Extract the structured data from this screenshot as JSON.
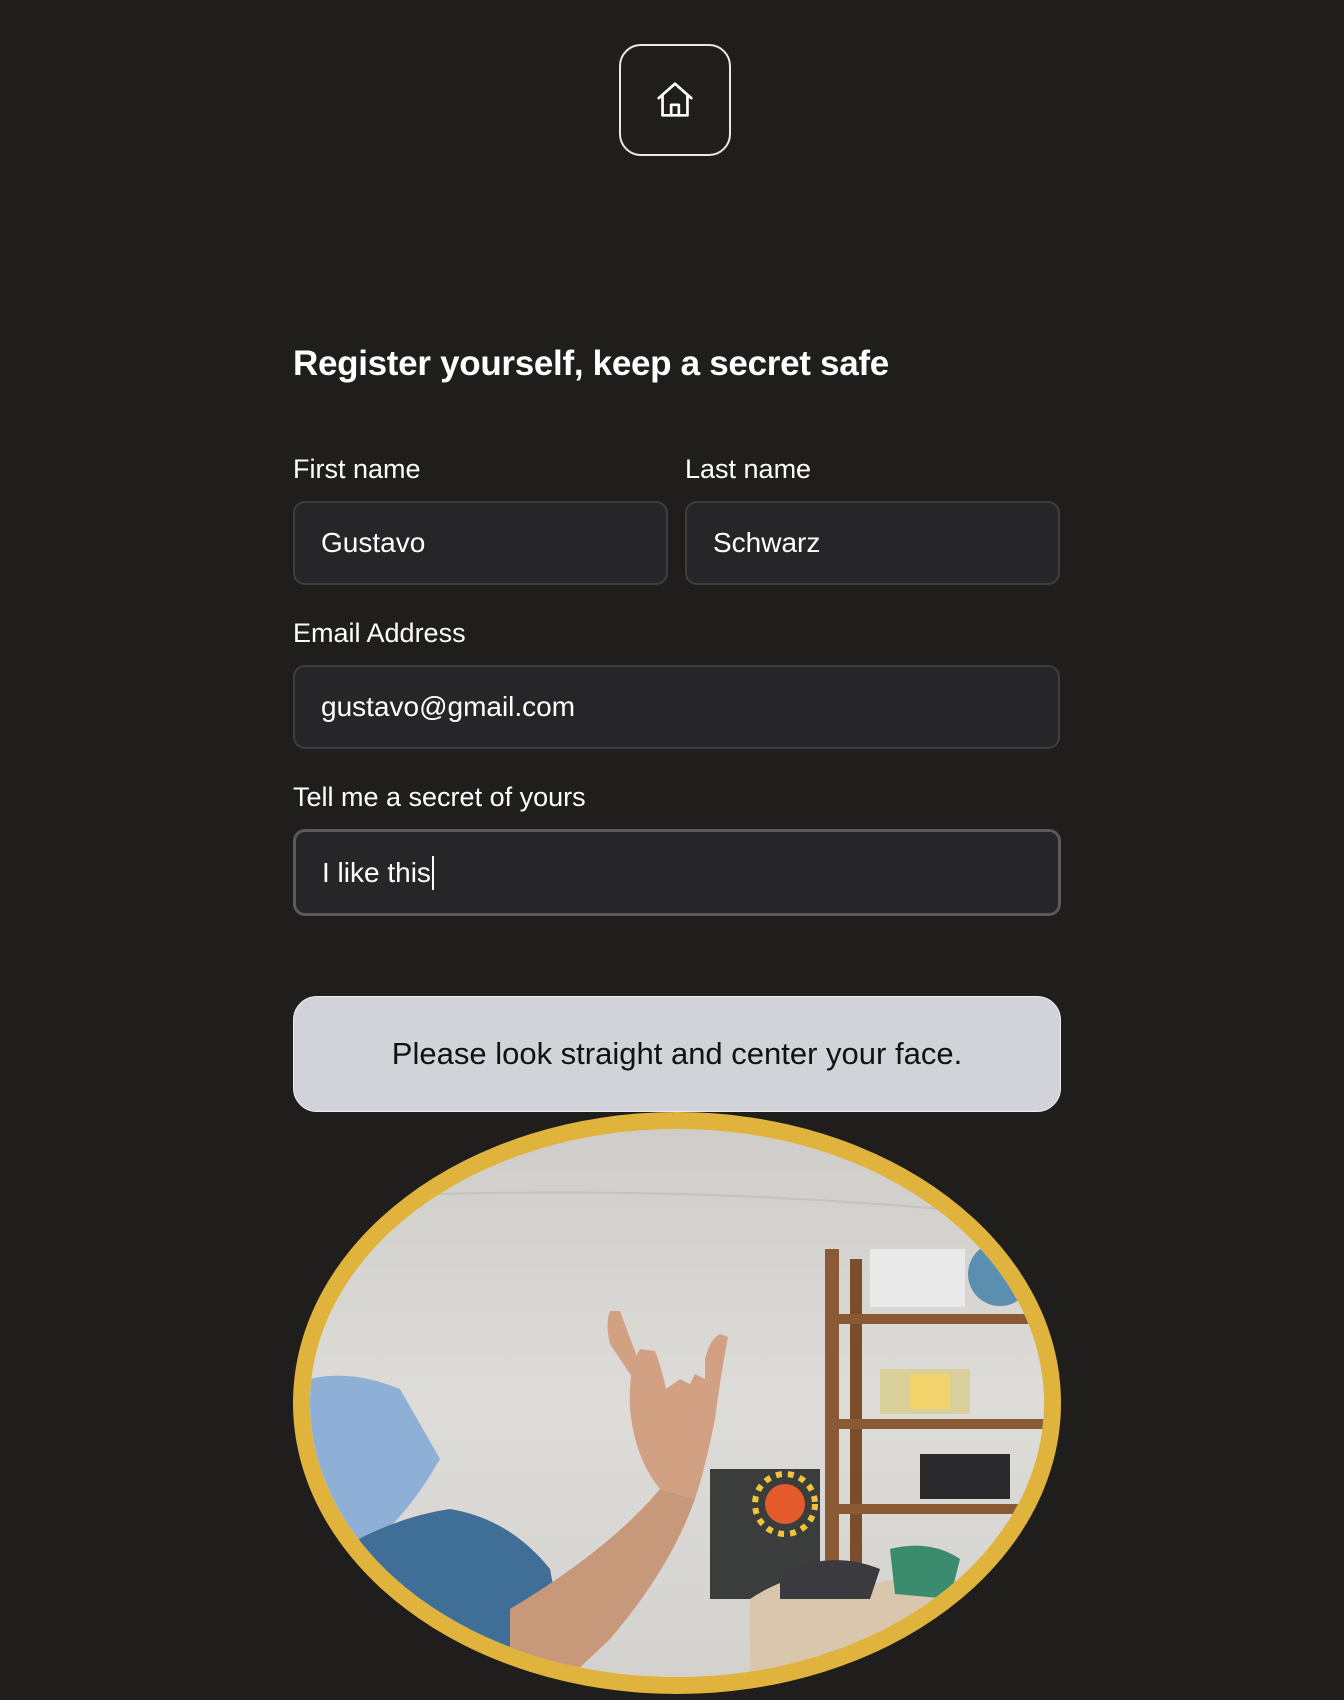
{
  "nav": {
    "home_icon": "home-icon"
  },
  "form": {
    "title": "Register yourself, keep a secret safe",
    "first_name": {
      "label": "First name",
      "value": "Gustavo"
    },
    "last_name": {
      "label": "Last name",
      "value": "Schwarz"
    },
    "email": {
      "label": "Email Address",
      "value": "gustavo@gmail.com"
    },
    "secret": {
      "label": "Tell me a secret of yours",
      "value": "I like this"
    }
  },
  "status_message": "Please look straight and center your face.",
  "colors": {
    "background": "#1f1e1d",
    "input_bg": "#262629",
    "status_bg": "#d1d3d8",
    "camera_ring": "#e0b43c"
  }
}
